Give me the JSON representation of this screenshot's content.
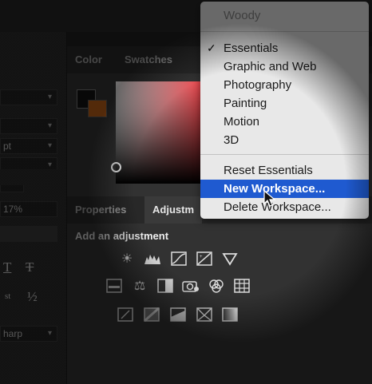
{
  "left_panel": {
    "font_size": "pt",
    "percent": "17%",
    "sharp": "harp",
    "glyph_t1": "T",
    "glyph_t2": "T",
    "glyph_st": "st",
    "glyph_half": "½"
  },
  "color_panel": {
    "tabs": [
      "Color",
      "Swatches"
    ],
    "foreground": "#111111",
    "background": "#b85c17"
  },
  "lower_panel": {
    "tabs": [
      "Properties",
      "Adjustm"
    ],
    "add_label": "Add an",
    "add_label_bold": "adjustment"
  },
  "adjustment_icons": [
    [
      "brightness-contrast-icon",
      "levels-icon",
      "curves-icon",
      "exposure-icon",
      "vibrance-icon"
    ],
    [
      "hue-saturation-icon",
      "color-balance-icon",
      "black-white-icon",
      "photo-filter-icon",
      "channel-mixer-icon",
      "color-lookup-icon"
    ],
    [
      "invert-icon",
      "posterize-icon",
      "threshold-icon",
      "selective-color-icon",
      "gradient-map-icon"
    ]
  ],
  "workspace_menu": {
    "items": [
      {
        "label": "Woody",
        "dim": true
      },
      {
        "label": "Essentials",
        "checked": true
      },
      {
        "label": "Graphic and Web"
      },
      {
        "label": "Photography"
      },
      {
        "label": "Painting"
      },
      {
        "label": "Motion"
      },
      {
        "label": "3D"
      },
      {
        "label": "Reset Essentials"
      },
      {
        "label": "New Workspace...",
        "selected": true
      },
      {
        "label": "Delete Workspace..."
      }
    ],
    "check_mark": "✓",
    "highlight_color": "#1f5ad0"
  }
}
